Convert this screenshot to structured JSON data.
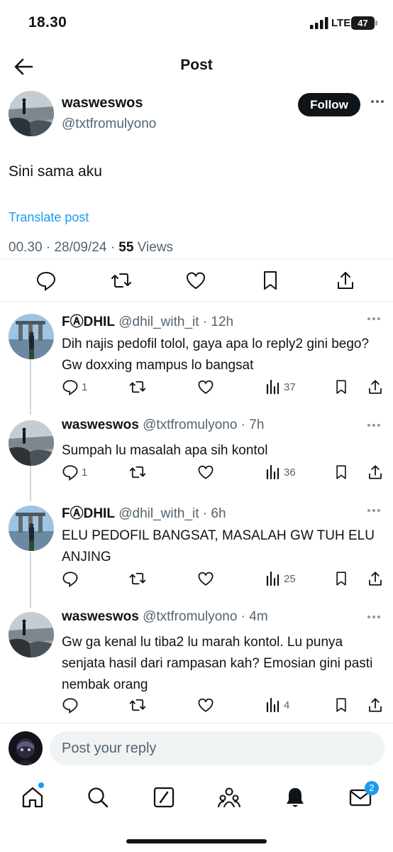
{
  "status_bar": {
    "time": "18.30",
    "network": "LTE",
    "battery": "47"
  },
  "header": {
    "title": "Post",
    "back_icon": "arrow-left-icon"
  },
  "post": {
    "author_name": "wasweswos",
    "author_handle": "@txtfromulyono",
    "follow_label": "Follow",
    "text": "Sini sama aku",
    "translate_label": "Translate post",
    "time": "00.30",
    "date": "28/09/24",
    "views_count": "55",
    "views_label": "Views"
  },
  "replies": [
    {
      "name": "FⒶDHIL",
      "handle": "@dhil_with_it",
      "age": "12h",
      "text": "Dih najis pedofil tolol, gaya apa lo reply2 gini bego? Gw doxxing mampus lo bangsat",
      "replies": "1",
      "views": "37"
    },
    {
      "name": "wasweswos",
      "handle": "@txtfromulyono",
      "age": "7h",
      "text": "Sumpah lu masalah apa sih kontol",
      "replies": "1",
      "views": "36"
    },
    {
      "name": "FⒶDHIL",
      "handle": "@dhil_with_it",
      "age": "6h",
      "text": "ELU PEDOFIL BANGSAT, MASALAH GW TUH ELU ANJING",
      "replies": "",
      "views": "25"
    },
    {
      "name": "wasweswos",
      "handle": "@txtfromulyono",
      "age": "4m",
      "text": "Gw ga kenal lu tiba2 lu marah kontol. Lu punya senjata hasil dari rampasan kah? Emosian gini pasti nembak orang",
      "replies": "",
      "views": "4"
    }
  ],
  "reply_box": {
    "placeholder": "Post your reply"
  },
  "tab_bar": {
    "messages_badge": "2"
  },
  "colors": {
    "accent": "#1d9bf0",
    "text": "#0f1419",
    "secondary": "#536471"
  }
}
